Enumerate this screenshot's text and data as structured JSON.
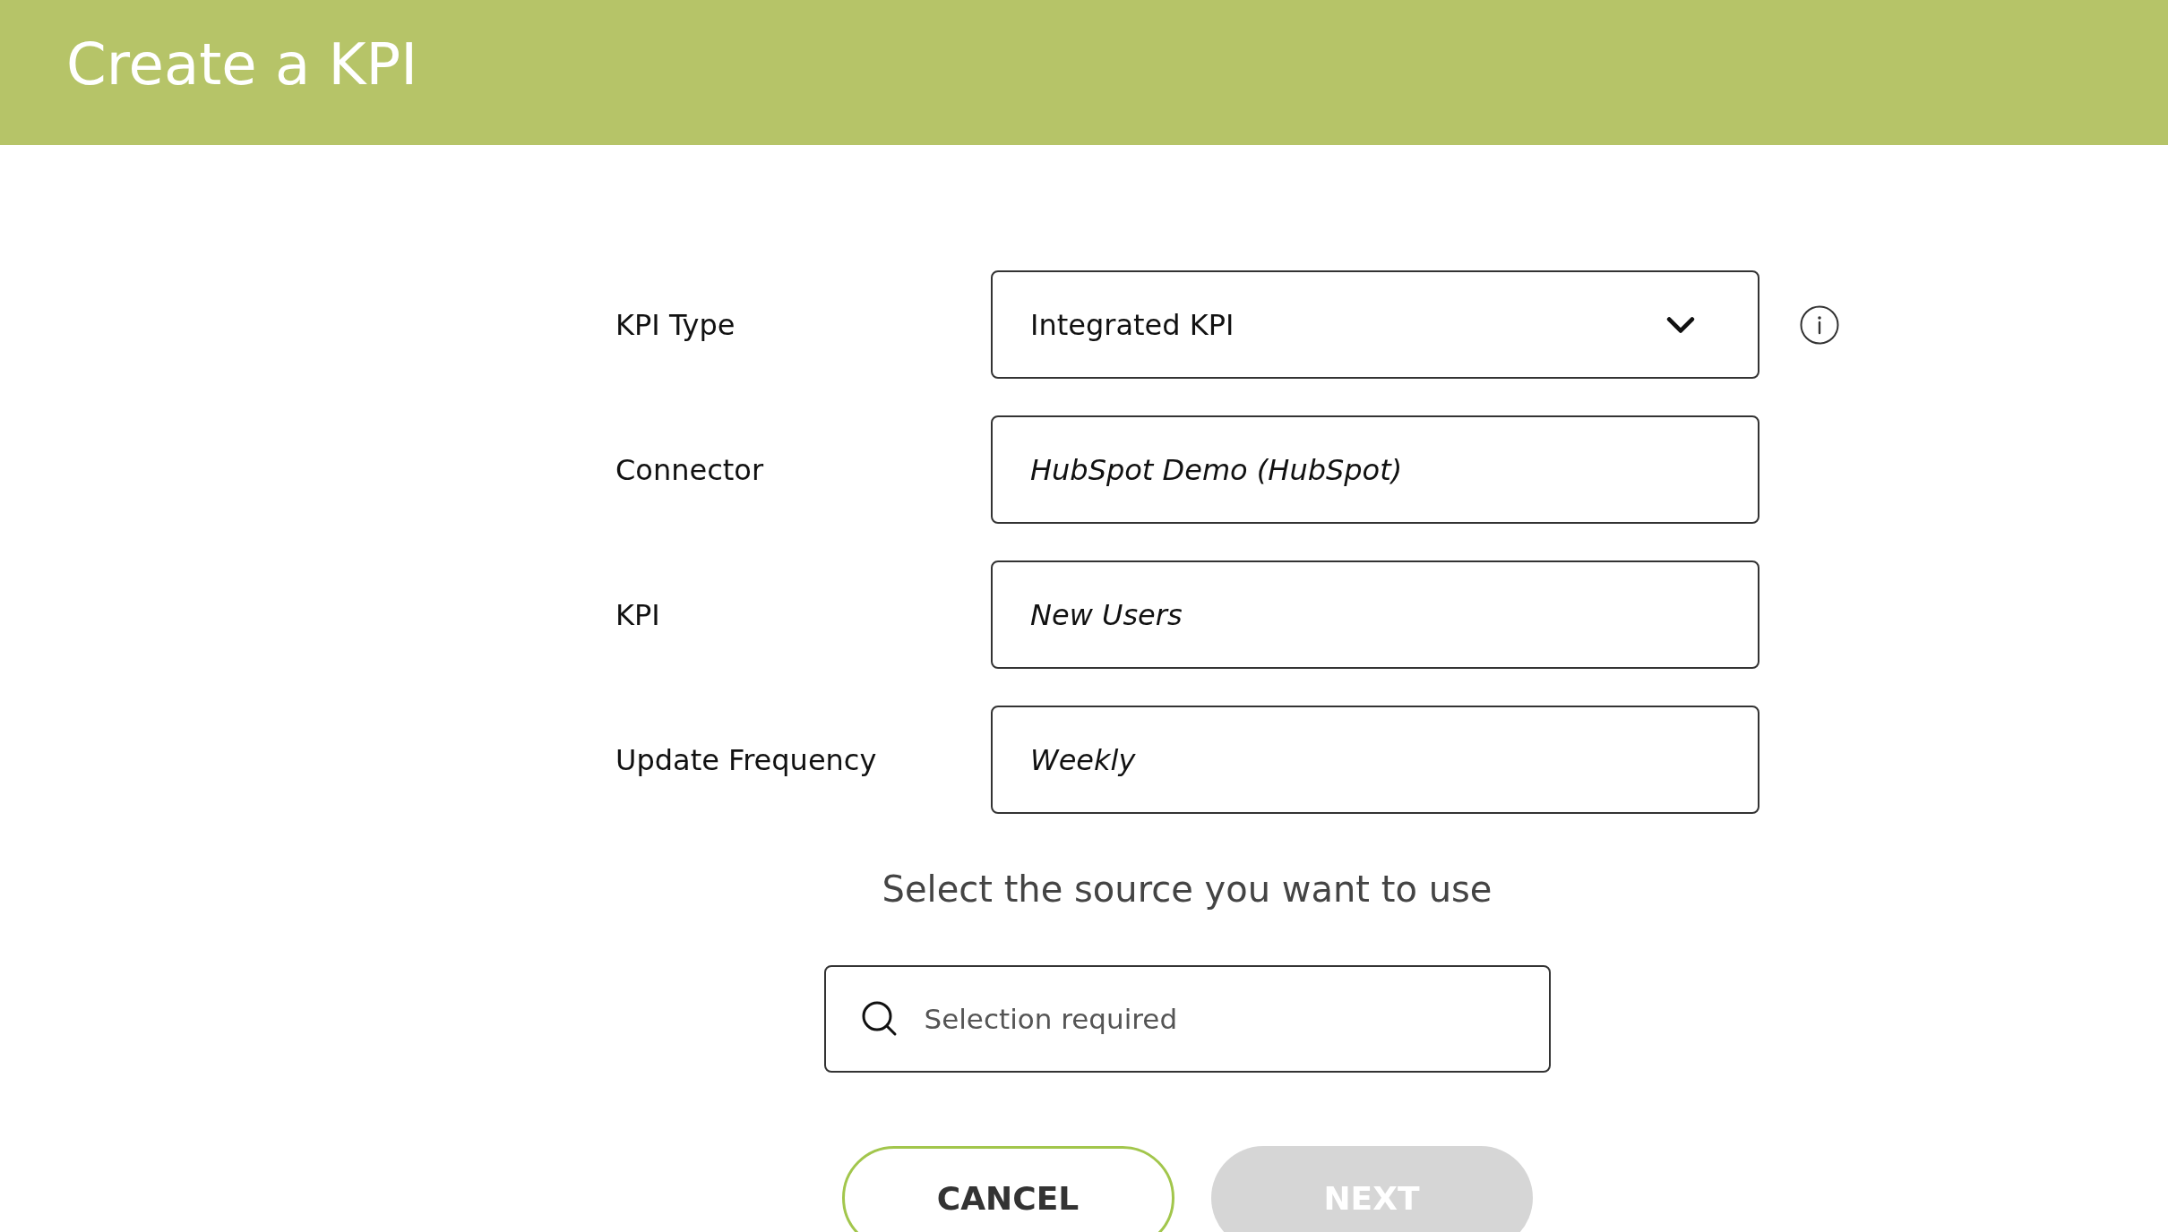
{
  "header": {
    "title": "Create a KPI"
  },
  "fields": [
    {
      "label": "KPI Type",
      "kind": "select",
      "value": "Integrated KPI",
      "info": true
    },
    {
      "label": "Connector",
      "kind": "text",
      "value": "HubSpot Demo (HubSpot)",
      "info": false
    },
    {
      "label": "KPI",
      "kind": "text",
      "value": "New Users",
      "info": false
    },
    {
      "label": "Update Frequency",
      "kind": "text",
      "value": "Weekly",
      "info": false
    }
  ],
  "source": {
    "prompt": "Select the source you want to use",
    "search": {
      "placeholder": "Selection required"
    }
  },
  "buttons": [
    {
      "label": "CANCEL",
      "kind": "outline",
      "disabled": false
    },
    {
      "label": "NEXT",
      "kind": "filled",
      "disabled": true
    }
  ]
}
